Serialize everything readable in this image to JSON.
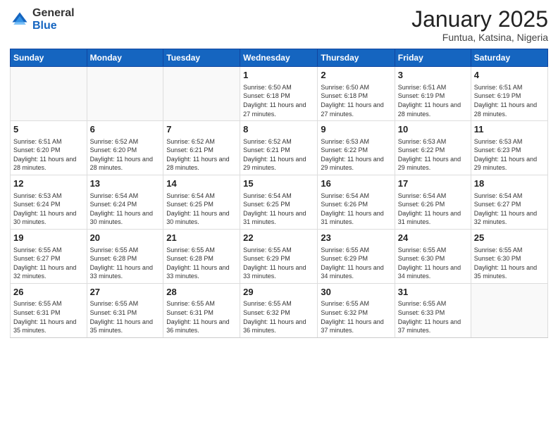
{
  "header": {
    "logo_general": "General",
    "logo_blue": "Blue",
    "month": "January 2025",
    "location": "Funtua, Katsina, Nigeria"
  },
  "days_of_week": [
    "Sunday",
    "Monday",
    "Tuesday",
    "Wednesday",
    "Thursday",
    "Friday",
    "Saturday"
  ],
  "weeks": [
    [
      {
        "day": "",
        "info": ""
      },
      {
        "day": "",
        "info": ""
      },
      {
        "day": "",
        "info": ""
      },
      {
        "day": "1",
        "info": "Sunrise: 6:50 AM\nSunset: 6:18 PM\nDaylight: 11 hours and 27 minutes."
      },
      {
        "day": "2",
        "info": "Sunrise: 6:50 AM\nSunset: 6:18 PM\nDaylight: 11 hours and 27 minutes."
      },
      {
        "day": "3",
        "info": "Sunrise: 6:51 AM\nSunset: 6:19 PM\nDaylight: 11 hours and 28 minutes."
      },
      {
        "day": "4",
        "info": "Sunrise: 6:51 AM\nSunset: 6:19 PM\nDaylight: 11 hours and 28 minutes."
      }
    ],
    [
      {
        "day": "5",
        "info": "Sunrise: 6:51 AM\nSunset: 6:20 PM\nDaylight: 11 hours and 28 minutes."
      },
      {
        "day": "6",
        "info": "Sunrise: 6:52 AM\nSunset: 6:20 PM\nDaylight: 11 hours and 28 minutes."
      },
      {
        "day": "7",
        "info": "Sunrise: 6:52 AM\nSunset: 6:21 PM\nDaylight: 11 hours and 28 minutes."
      },
      {
        "day": "8",
        "info": "Sunrise: 6:52 AM\nSunset: 6:21 PM\nDaylight: 11 hours and 29 minutes."
      },
      {
        "day": "9",
        "info": "Sunrise: 6:53 AM\nSunset: 6:22 PM\nDaylight: 11 hours and 29 minutes."
      },
      {
        "day": "10",
        "info": "Sunrise: 6:53 AM\nSunset: 6:22 PM\nDaylight: 11 hours and 29 minutes."
      },
      {
        "day": "11",
        "info": "Sunrise: 6:53 AM\nSunset: 6:23 PM\nDaylight: 11 hours and 29 minutes."
      }
    ],
    [
      {
        "day": "12",
        "info": "Sunrise: 6:53 AM\nSunset: 6:24 PM\nDaylight: 11 hours and 30 minutes."
      },
      {
        "day": "13",
        "info": "Sunrise: 6:54 AM\nSunset: 6:24 PM\nDaylight: 11 hours and 30 minutes."
      },
      {
        "day": "14",
        "info": "Sunrise: 6:54 AM\nSunset: 6:25 PM\nDaylight: 11 hours and 30 minutes."
      },
      {
        "day": "15",
        "info": "Sunrise: 6:54 AM\nSunset: 6:25 PM\nDaylight: 11 hours and 31 minutes."
      },
      {
        "day": "16",
        "info": "Sunrise: 6:54 AM\nSunset: 6:26 PM\nDaylight: 11 hours and 31 minutes."
      },
      {
        "day": "17",
        "info": "Sunrise: 6:54 AM\nSunset: 6:26 PM\nDaylight: 11 hours and 31 minutes."
      },
      {
        "day": "18",
        "info": "Sunrise: 6:54 AM\nSunset: 6:27 PM\nDaylight: 11 hours and 32 minutes."
      }
    ],
    [
      {
        "day": "19",
        "info": "Sunrise: 6:55 AM\nSunset: 6:27 PM\nDaylight: 11 hours and 32 minutes."
      },
      {
        "day": "20",
        "info": "Sunrise: 6:55 AM\nSunset: 6:28 PM\nDaylight: 11 hours and 33 minutes."
      },
      {
        "day": "21",
        "info": "Sunrise: 6:55 AM\nSunset: 6:28 PM\nDaylight: 11 hours and 33 minutes."
      },
      {
        "day": "22",
        "info": "Sunrise: 6:55 AM\nSunset: 6:29 PM\nDaylight: 11 hours and 33 minutes."
      },
      {
        "day": "23",
        "info": "Sunrise: 6:55 AM\nSunset: 6:29 PM\nDaylight: 11 hours and 34 minutes."
      },
      {
        "day": "24",
        "info": "Sunrise: 6:55 AM\nSunset: 6:30 PM\nDaylight: 11 hours and 34 minutes."
      },
      {
        "day": "25",
        "info": "Sunrise: 6:55 AM\nSunset: 6:30 PM\nDaylight: 11 hours and 35 minutes."
      }
    ],
    [
      {
        "day": "26",
        "info": "Sunrise: 6:55 AM\nSunset: 6:31 PM\nDaylight: 11 hours and 35 minutes."
      },
      {
        "day": "27",
        "info": "Sunrise: 6:55 AM\nSunset: 6:31 PM\nDaylight: 11 hours and 35 minutes."
      },
      {
        "day": "28",
        "info": "Sunrise: 6:55 AM\nSunset: 6:31 PM\nDaylight: 11 hours and 36 minutes."
      },
      {
        "day": "29",
        "info": "Sunrise: 6:55 AM\nSunset: 6:32 PM\nDaylight: 11 hours and 36 minutes."
      },
      {
        "day": "30",
        "info": "Sunrise: 6:55 AM\nSunset: 6:32 PM\nDaylight: 11 hours and 37 minutes."
      },
      {
        "day": "31",
        "info": "Sunrise: 6:55 AM\nSunset: 6:33 PM\nDaylight: 11 hours and 37 minutes."
      },
      {
        "day": "",
        "info": ""
      }
    ]
  ]
}
